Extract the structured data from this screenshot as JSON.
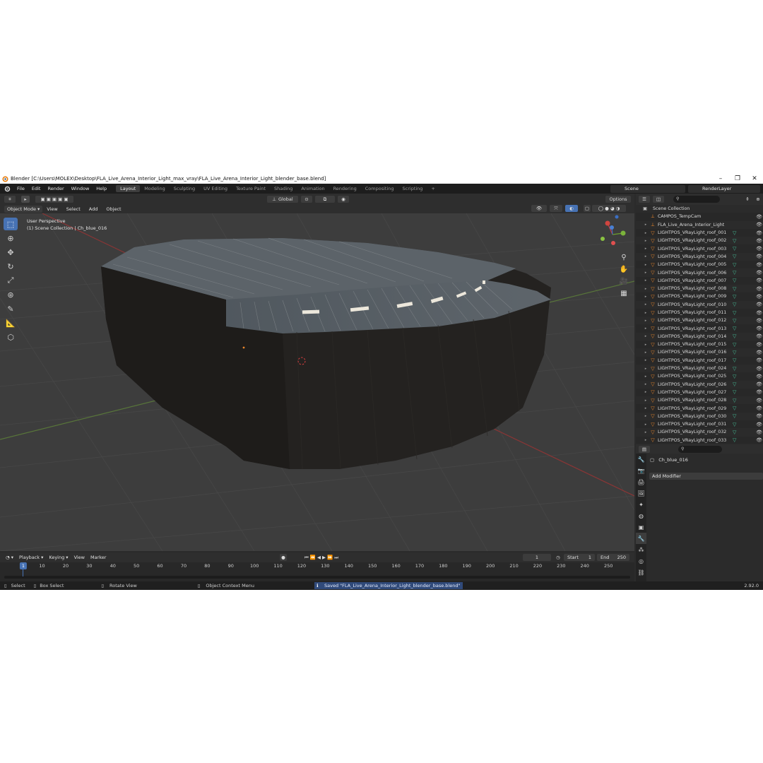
{
  "window": {
    "title": "Blender [C:\\Users\\MOLEX\\Desktop\\FLA_Live_Arena_Interior_Light_max_vray\\FLA_Live_Arena_Interior_Light_blender_base.blend]",
    "minimize": "–",
    "maximize": "❐",
    "close": "✕"
  },
  "menu": {
    "items": [
      "File",
      "Edit",
      "Render",
      "Window",
      "Help"
    ],
    "workspaces": [
      "Layout",
      "Modeling",
      "Sculpting",
      "UV Editing",
      "Texture Paint",
      "Shading",
      "Animation",
      "Rendering",
      "Compositing",
      "Scripting"
    ],
    "add_workspace": "+",
    "scene": "Scene",
    "render_layer": "RenderLayer"
  },
  "viewport_header": {
    "mode": "Object Mode",
    "menus": [
      "View",
      "Select",
      "Add",
      "Object"
    ],
    "orientation": "Global",
    "options": "Options"
  },
  "viewport": {
    "view_name": "User Perspective",
    "collection_path": "(1) Scene Collection | Ch_blue_016"
  },
  "timeline": {
    "menus": [
      "Playback",
      "Keying",
      "View",
      "Marker"
    ],
    "current_frame": "1",
    "start_label": "Start",
    "start": "1",
    "end_label": "End",
    "end": "250",
    "ticks": [
      "10",
      "20",
      "30",
      "40",
      "50",
      "60",
      "70",
      "80",
      "90",
      "100",
      "110",
      "120",
      "130",
      "140",
      "150",
      "160",
      "170",
      "180",
      "190",
      "200",
      "210",
      "220",
      "230",
      "240",
      "250"
    ]
  },
  "status": {
    "select": "Select",
    "box_select": "Box Select",
    "rotate_view": "Rotate View",
    "context_menu": "Object Context Menu",
    "saved": "Saved \"FLA_Live_Arena_Interior_Light_blender_base.blend\"",
    "version": "2.92.0"
  },
  "outliner": {
    "root": "Scene Collection",
    "items": [
      "CAMPOS_TempCam",
      "FLA_Live_Arena_Interior_Light",
      "LIGHTPOS_VRayLight_roof_001",
      "LIGHTPOS_VRayLight_roof_002",
      "LIGHTPOS_VRayLight_roof_003",
      "LIGHTPOS_VRayLight_roof_004",
      "LIGHTPOS_VRayLight_roof_005",
      "LIGHTPOS_VRayLight_roof_006",
      "LIGHTPOS_VRayLight_roof_007",
      "LIGHTPOS_VRayLight_roof_008",
      "LIGHTPOS_VRayLight_roof_009",
      "LIGHTPOS_VRayLight_roof_010",
      "LIGHTPOS_VRayLight_roof_011",
      "LIGHTPOS_VRayLight_roof_012",
      "LIGHTPOS_VRayLight_roof_013",
      "LIGHTPOS_VRayLight_roof_014",
      "LIGHTPOS_VRayLight_roof_015",
      "LIGHTPOS_VRayLight_roof_016",
      "LIGHTPOS_VRayLight_roof_017",
      "LIGHTPOS_VRayLight_roof_024",
      "LIGHTPOS_VRayLight_roof_025",
      "LIGHTPOS_VRayLight_roof_026",
      "LIGHTPOS_VRayLight_roof_027",
      "LIGHTPOS_VRayLight_roof_028",
      "LIGHTPOS_VRayLight_roof_029",
      "LIGHTPOS_VRayLight_roof_030",
      "LIGHTPOS_VRayLight_roof_031",
      "LIGHTPOS_VRayLight_roof_032",
      "LIGHTPOS_VRayLight_roof_033"
    ]
  },
  "properties": {
    "object_name": "Ch_blue_016",
    "add_modifier": "Add Modifier"
  },
  "colors": {
    "accent": "#4772b3",
    "object_orange": "#e9852a",
    "light_green": "#45c29a",
    "x_axis": "#c83c3c",
    "y_axis": "#6ea02c"
  }
}
